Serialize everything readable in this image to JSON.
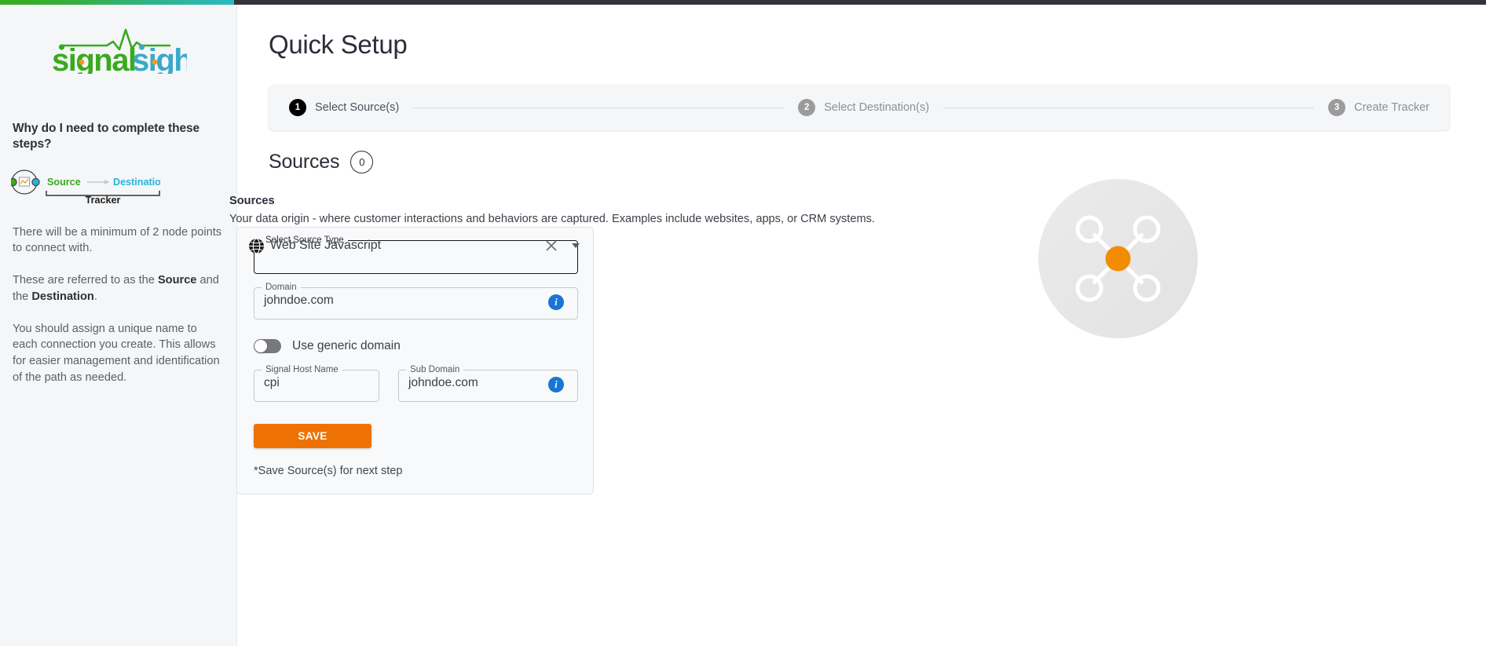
{
  "brand": {
    "logo_text_1": "signal",
    "logo_text_2": "sight",
    "accent_green": "#3aaa1e",
    "accent_blue": "#2bb8c6",
    "accent_orange": "#ee7203"
  },
  "sidebar": {
    "heading": "Why do I need to complete these steps?",
    "diagram": {
      "source_label": "Source",
      "destination_label": "Destination",
      "tracker_label": "Tracker"
    },
    "paragraphs": [
      {
        "pre": "There will be a minimum of 2 node points to connect with.",
        "bold1": "",
        "mid": "",
        "bold2": "",
        "post": ""
      },
      {
        "pre": "These are referred to as the ",
        "bold1": "Source",
        "mid": " and the ",
        "bold2": "Destination",
        "post": "."
      },
      {
        "pre": "You should assign a unique name to each connection you create. This allows for easier management and identification of the path as needed.",
        "bold1": "",
        "mid": "",
        "bold2": "",
        "post": ""
      }
    ]
  },
  "main": {
    "page_title": "Quick Setup",
    "stepper": {
      "steps": [
        {
          "num": "1",
          "label": "Select Source(s)",
          "state": "active"
        },
        {
          "num": "2",
          "label": "Select Destination(s)",
          "state": "inactive"
        },
        {
          "num": "3",
          "label": "Create Tracker",
          "state": "inactive"
        }
      ]
    },
    "sources": {
      "title": "Sources",
      "count": "0",
      "sub_heading": "Sources",
      "description": "Your data origin - where customer interactions and behaviors are captured. Examples include websites, apps, or CRM systems."
    },
    "form": {
      "source_type": {
        "label": "Select Source Type",
        "value": "Web Site Javascript",
        "icon": "globe-icon",
        "clear_icon": "close-icon",
        "arrow_icon": "chevron-down-icon"
      },
      "domain": {
        "label": "Domain",
        "value": "johndoe.com",
        "placeholder": "Domain",
        "info_icon": "info-icon"
      },
      "generic_domain_toggle": {
        "label": "Use generic domain",
        "state": "off"
      },
      "signal_host_name": {
        "label": "Signal Host Name",
        "value": "cpi",
        "placeholder": "Signal Host Name"
      },
      "sub_domain": {
        "label": "Sub Domain",
        "value": "johndoe.com",
        "placeholder": "Sub Domain",
        "info_icon": "info-icon"
      },
      "save_label": "SAVE",
      "save_note": "*Save Source(s) for next step"
    }
  }
}
